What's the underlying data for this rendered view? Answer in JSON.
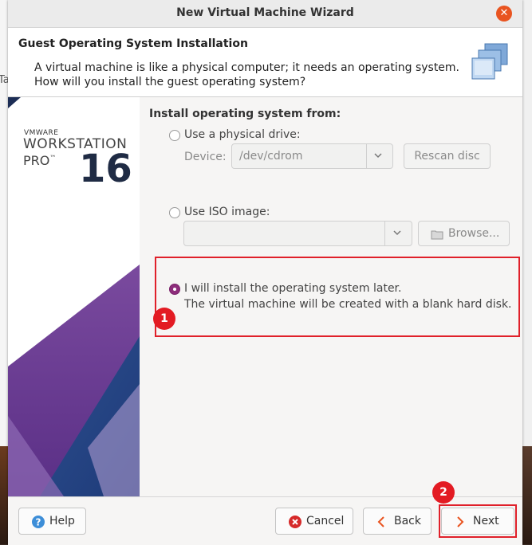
{
  "window": {
    "title": "New Virtual Machine Wizard"
  },
  "background": {
    "left_tab_text": "Ta"
  },
  "header": {
    "title": "Guest Operating System Installation",
    "desc_line1": "A virtual machine is like a physical computer; it needs an operating system.",
    "desc_line2": "How will you install the guest operating system?"
  },
  "sidebar": {
    "brand": "VMWARE",
    "product": "WORKSTATION",
    "edition": "PRO",
    "trademark": "™",
    "version": "16"
  },
  "install": {
    "section_label": "Install operating system from:",
    "physical": {
      "label": "Use a physical drive:",
      "device_label": "Device:",
      "device_value": "/dev/cdrom",
      "rescan_label": "Rescan disc"
    },
    "iso": {
      "label": "Use ISO image:",
      "path_value": "",
      "browse_label": "Browse..."
    },
    "later": {
      "line1": "I will install the operating system later.",
      "line2": "The virtual machine will be created with a blank hard disk."
    }
  },
  "annotations": {
    "badge1": "1",
    "badge2": "2"
  },
  "footer": {
    "help": "Help",
    "cancel": "Cancel",
    "back": "Back",
    "next": "Next"
  },
  "colors": {
    "accent_radio": "#8d2d7b",
    "close_button": "#e95420",
    "annotation": "#e31b23",
    "back_next_chevron": "#e95420"
  }
}
